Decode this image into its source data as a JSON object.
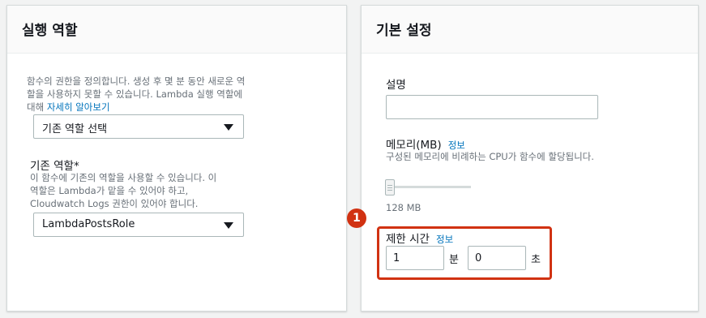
{
  "left_panel": {
    "title": "실행 역할",
    "description": "함수의 권한을 정의합니다. 생성 후 몇 분 동안 새로운 역할을 사용하지 못할 수 있습니다. Lambda 실행 역할에 대해 ",
    "description_link": "자세히 알아보기",
    "role_select_value": "기존 역할 선택",
    "existing_role_label": "기존 역할*",
    "existing_role_desc_line1": "이 함수에 기존의 역할을 사용할 수 있습니다. 이",
    "existing_role_desc_line2": "역할은 Lambda가 맡을 수 있어야 하고,",
    "existing_role_desc_line3": "Cloudwatch Logs 권한이 있어야 합니다.",
    "existing_role_value": "LambdaPostsRole"
  },
  "right_panel": {
    "title": "기본 설정",
    "description_label": "설명",
    "description_value": "",
    "memory_label": "메모리(MB)",
    "memory_info": "정보",
    "memory_desc": "구성된 메모리에 비례하는 CPU가 함수에 할당됩니다.",
    "memory_value": "128 MB",
    "memory_fraction": 0.0,
    "timeout_label": "제한 시간",
    "timeout_info": "정보",
    "timeout_minutes": "1",
    "timeout_minutes_unit": "분",
    "timeout_seconds": "0",
    "timeout_seconds_unit": "초",
    "callout_number": "1"
  },
  "colors": {
    "highlight": "#d13212",
    "link": "#0073bb",
    "muted_text": "#687078"
  }
}
